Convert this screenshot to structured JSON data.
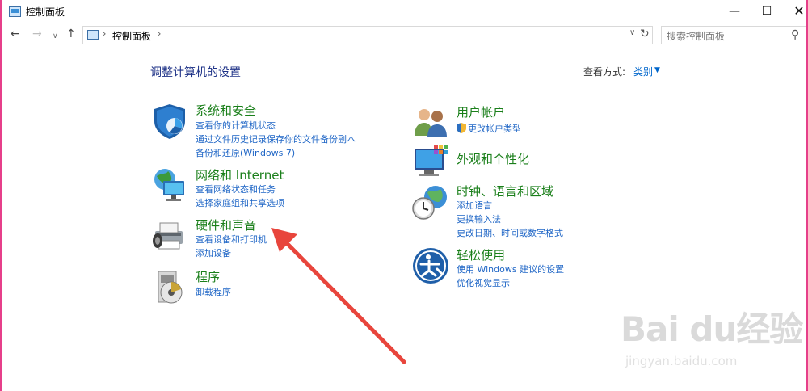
{
  "window": {
    "title": "控制面板",
    "minimize_glyph": "—",
    "maximize_glyph": "☐",
    "close_glyph": "✕"
  },
  "nav": {
    "back_glyph": "←",
    "forward_glyph": "→",
    "recent_glyph": "∨",
    "up_glyph": "↑"
  },
  "address": {
    "separator": "›",
    "path": "控制面板",
    "dropdown_glyph": "∨",
    "refresh_glyph": "↻"
  },
  "search": {
    "placeholder": "搜索控制面板",
    "icon_glyph": "⚲"
  },
  "main": {
    "title": "调整计算机的设置",
    "view_by_label": "查看方式:",
    "view_by_value": "类别",
    "view_by_caret": "▼"
  },
  "categories_left": [
    {
      "title": "系统和安全",
      "icon": "shield-icon",
      "links": [
        "查看你的计算机状态",
        "通过文件历史记录保存你的文件备份副本",
        "备份和还原(Windows 7)"
      ]
    },
    {
      "title": "网络和 Internet",
      "icon": "network-globe-icon",
      "links": [
        "查看网络状态和任务",
        "选择家庭组和共享选项"
      ]
    },
    {
      "title": "硬件和声音",
      "icon": "printer-speaker-icon",
      "links": [
        "查看设备和打印机",
        "添加设备"
      ]
    },
    {
      "title": "程序",
      "icon": "programs-disc-icon",
      "links": [
        "卸载程序"
      ]
    }
  ],
  "categories_right": [
    {
      "title": "用户帐户",
      "icon": "users-icon",
      "links": [
        "更改帐户类型"
      ]
    },
    {
      "title": "外观和个性化",
      "icon": "monitor-palette-icon",
      "links": []
    },
    {
      "title": "时钟、语言和区域",
      "icon": "clock-globe-icon",
      "links": [
        "添加语言",
        "更换输入法",
        "更改日期、时间或数字格式"
      ]
    },
    {
      "title": "轻松使用",
      "icon": "accessibility-icon",
      "links": [
        "使用 Windows 建议的设置",
        "优化视觉显示"
      ]
    }
  ],
  "watermark": {
    "brand": "Bai du经验",
    "url": "jingyan.baidu.com"
  },
  "colors": {
    "border": "#e63f8a",
    "category_title": "#1a7f1a",
    "link": "#1f66c6",
    "page_title": "#1e3287",
    "arrow": "#e8453c"
  }
}
